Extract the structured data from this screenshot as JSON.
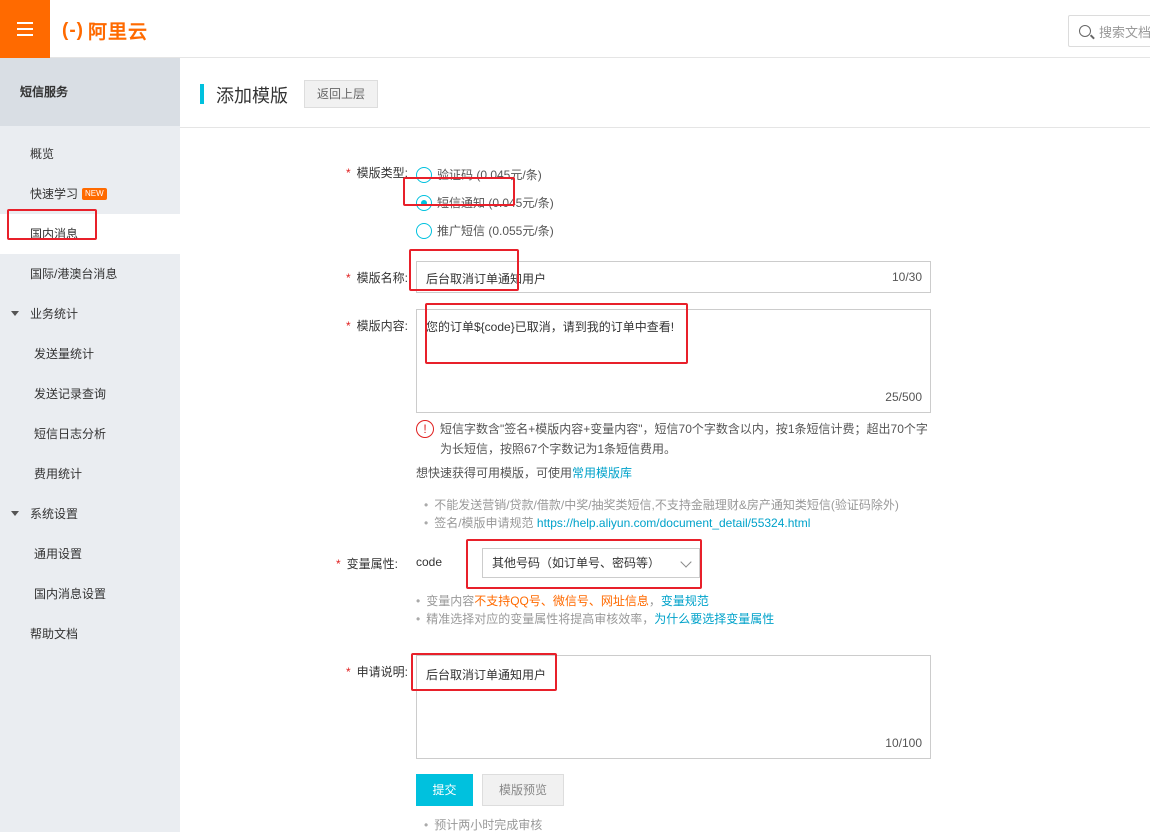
{
  "header": {
    "logo_text": "阿里云",
    "logo_mark": "(-)",
    "search_placeholder": "搜索文档"
  },
  "sidebar": {
    "title": "短信服务",
    "items": [
      {
        "label": "概览"
      },
      {
        "label": "快速学习",
        "badge": "NEW"
      },
      {
        "label": "国内消息"
      },
      {
        "label": "国际/港澳台消息"
      },
      {
        "label": "业务统计"
      },
      {
        "label": "发送量统计"
      },
      {
        "label": "发送记录查询"
      },
      {
        "label": "短信日志分析"
      },
      {
        "label": "费用统计"
      },
      {
        "label": "系统设置"
      },
      {
        "label": "通用设置"
      },
      {
        "label": "国内消息设置"
      },
      {
        "label": "帮助文档"
      }
    ]
  },
  "page": {
    "title": "添加模版",
    "back_label": "返回上层"
  },
  "form": {
    "required_mark": "*",
    "type_label": "模版类型:",
    "type_options": [
      {
        "label": "验证码 (0.045元/条)",
        "checked": false
      },
      {
        "label": "短信通知 (0.045元/条)",
        "checked": true
      },
      {
        "label": "推广短信 (0.055元/条)",
        "checked": false
      }
    ],
    "name_label": "模版名称:",
    "name_value": "后台取消订单通知用户",
    "name_counter": "10/30",
    "content_label": "模版内容:",
    "content_value": "您的订单${code}已取消，请到我的订单中查看!",
    "content_counter": "25/500",
    "notice_icon": "!",
    "notice_text": "短信字数含\"签名+模版内容+变量内容\"，短信70个字数含以内，按1条短信计费；超出70个字为长短信，按照67个字数记为1条短信费用。",
    "template_lib_prefix": "想快速获得可用模版，可使用",
    "template_lib_link": "常用模版库",
    "rule_1": "不能发送营销/贷款/借款/中奖/抽奖类短信,不支持金融理财&房产通知类短信(验证码除外)",
    "rule_2_prefix": "签名/模版申请规范",
    "rule_2_link": "https://help.aliyun.com/document_detail/55324.html",
    "var_label": "变量属性:",
    "var_name": "code",
    "var_select_value": "其他号码（如订单号、密码等）",
    "var_tip_1_prefix": "变量内容",
    "var_tip_1_warn": "不支持QQ号、微信号、网址信息",
    "var_tip_1_sep": "，",
    "var_tip_1_link": "变量规范",
    "var_tip_2_prefix": "精准选择对应的变量属性将提高审核效率，",
    "var_tip_2_link": "为什么要选择变量属性",
    "desc_label": "申请说明:",
    "desc_value": "后台取消订单通知用户",
    "desc_counter": "10/100",
    "submit_label": "提交",
    "preview_label": "模版预览",
    "footer_tip": "预计两小时完成审核"
  },
  "colors": {
    "brand": "#ff6a00",
    "accent": "#00c1de",
    "highlight": "#e8202a"
  }
}
